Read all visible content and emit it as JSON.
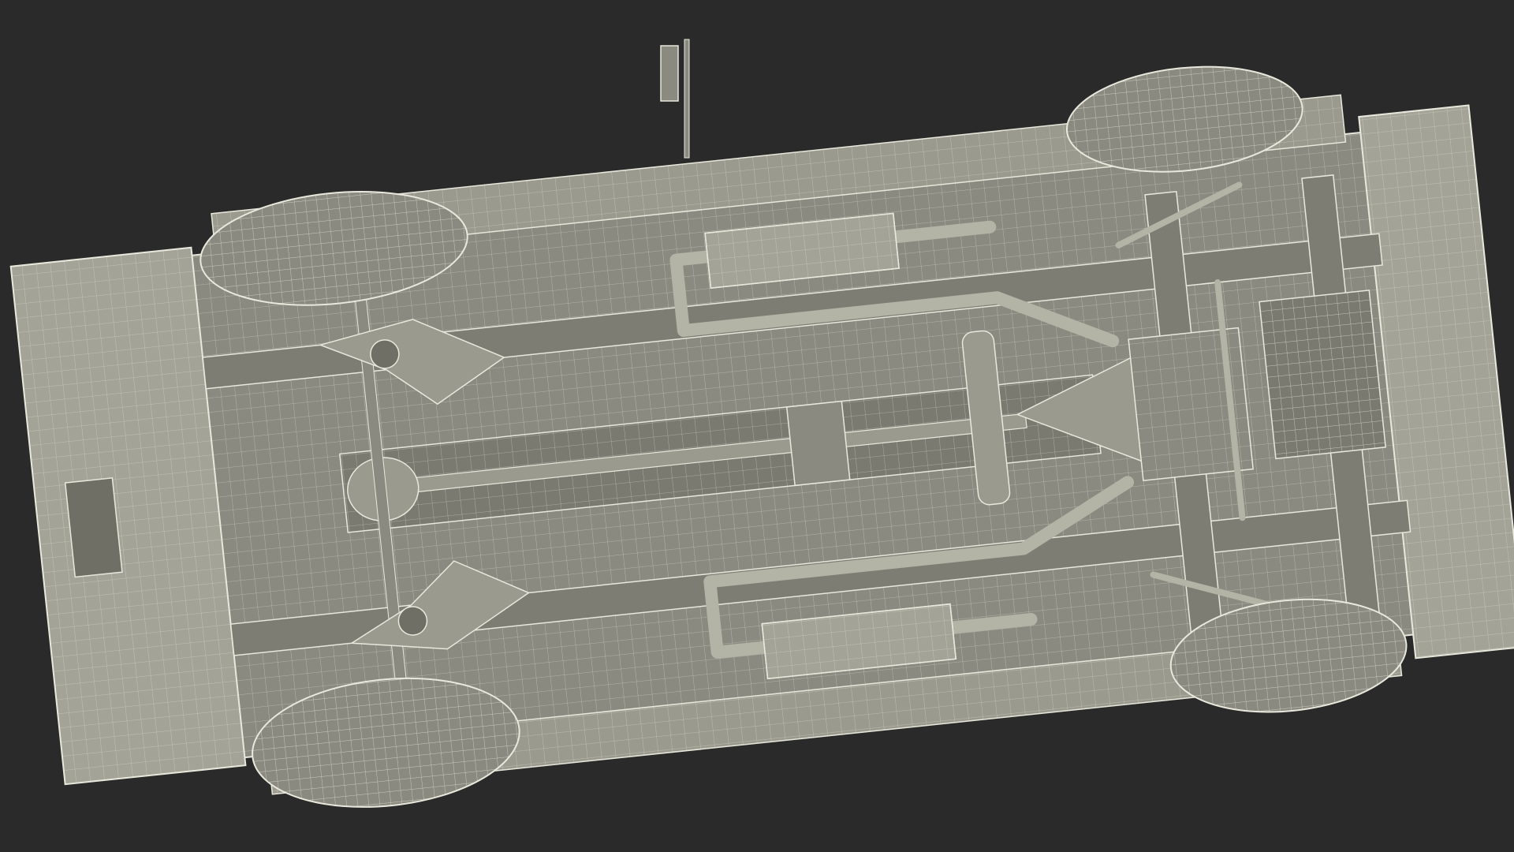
{
  "scene": {
    "description_visible_text": "",
    "colors": {
      "background": "#2a2a2a",
      "body": "#8a8a80",
      "body_dark": "#6f6f66",
      "body_light": "#a3a397",
      "wire": "#e8e8dc",
      "shadow": "#1c1c1c"
    },
    "icons": [
      "car-underside-wireframe"
    ]
  }
}
